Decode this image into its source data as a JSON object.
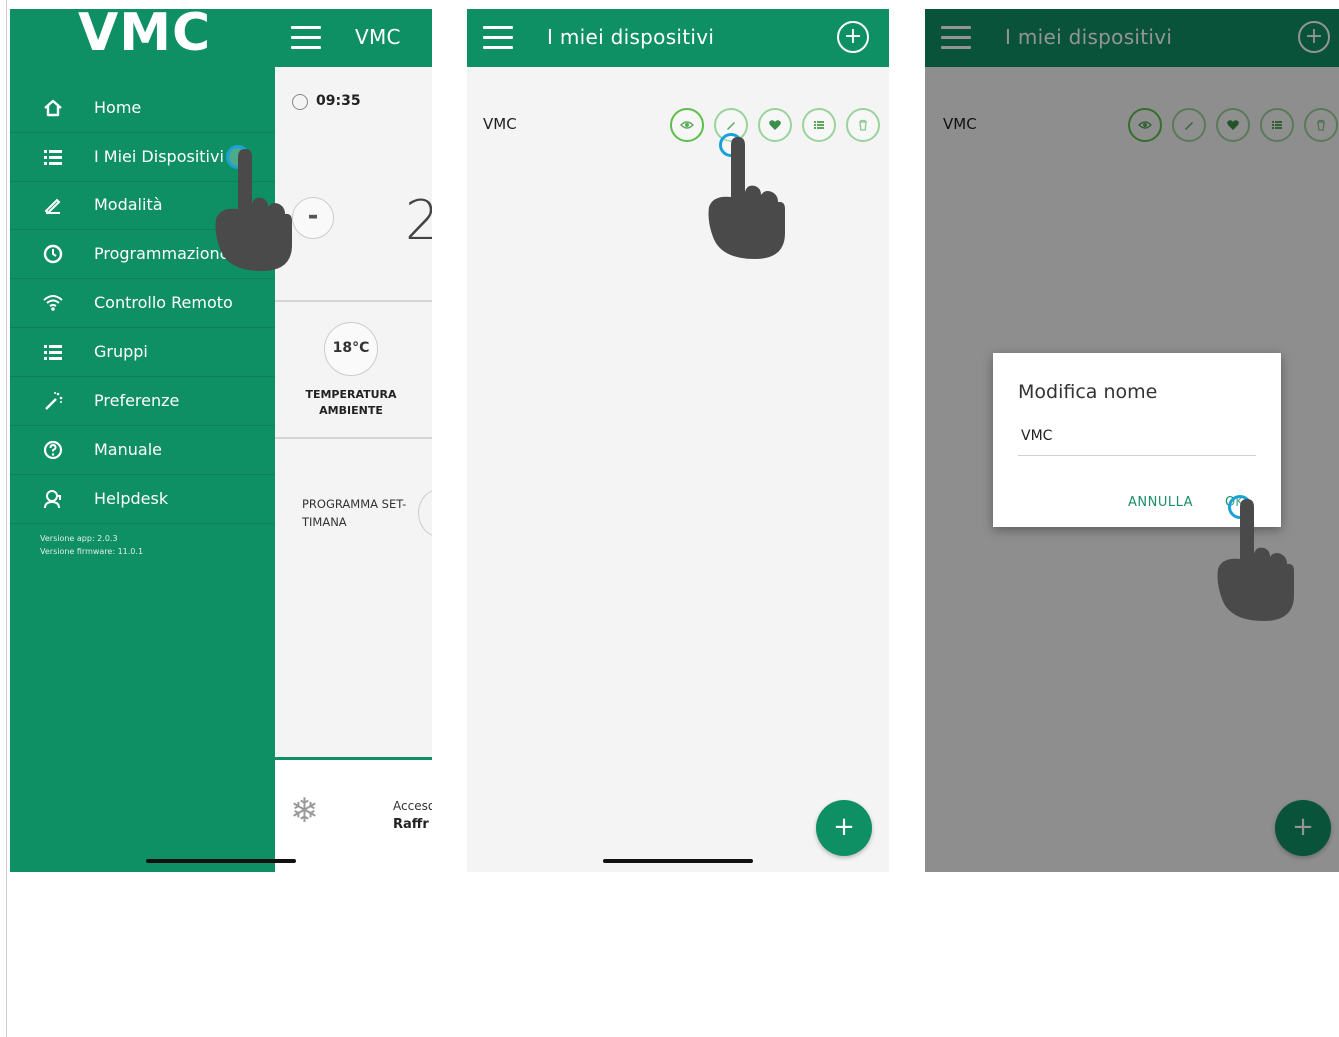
{
  "screen1": {
    "brand": "VMC",
    "header_title": "VMC",
    "time": "09:35",
    "setpoint_partial": "2",
    "temperature": "18°C",
    "temperature_label_line1": "TEMPERATURA",
    "temperature_label_line2": "AMBIENTE",
    "program_label_line1": "PROGRAMMA SET-",
    "program_label_line2": "TIMANA",
    "status_line1": "Acceso",
    "status_line2": "Raffr",
    "menu": [
      {
        "label": "Home",
        "icon": "home-icon"
      },
      {
        "label": "I Miei Dispositivi",
        "icon": "list-icon"
      },
      {
        "label": "Modalità",
        "icon": "pencil-icon"
      },
      {
        "label": "Programmazione",
        "icon": "clock-icon"
      },
      {
        "label": "Controllo Remoto",
        "icon": "wifi-icon"
      },
      {
        "label": "Gruppi",
        "icon": "list-icon"
      },
      {
        "label": "Preferenze",
        "icon": "magic-wand-icon"
      },
      {
        "label": "Manuale",
        "icon": "help-icon"
      },
      {
        "label": "Helpdesk",
        "icon": "support-icon"
      }
    ],
    "app_version": "Versione app: 2.0.3",
    "firmware_version": "Versione firmware: 11.0.1"
  },
  "screen2": {
    "header_title": "I miei dispositivi",
    "device_name": "VMC",
    "actions": [
      "eye-icon",
      "pencil-icon",
      "heart-icon",
      "list-icon",
      "trash-icon"
    ],
    "fab_label": "+"
  },
  "screen3": {
    "header_title": "I miei dispositivi",
    "device_name": "VMC",
    "dialog_title": "Modifica nome",
    "dialog_value": "VMC",
    "cancel_label": "ANNULLA",
    "ok_label": "OK",
    "fab_label": "+"
  },
  "colors": {
    "brand_green": "#0f8f64",
    "icon_ring": "#9ad39c",
    "touch_ring": "#1ca0d8"
  }
}
